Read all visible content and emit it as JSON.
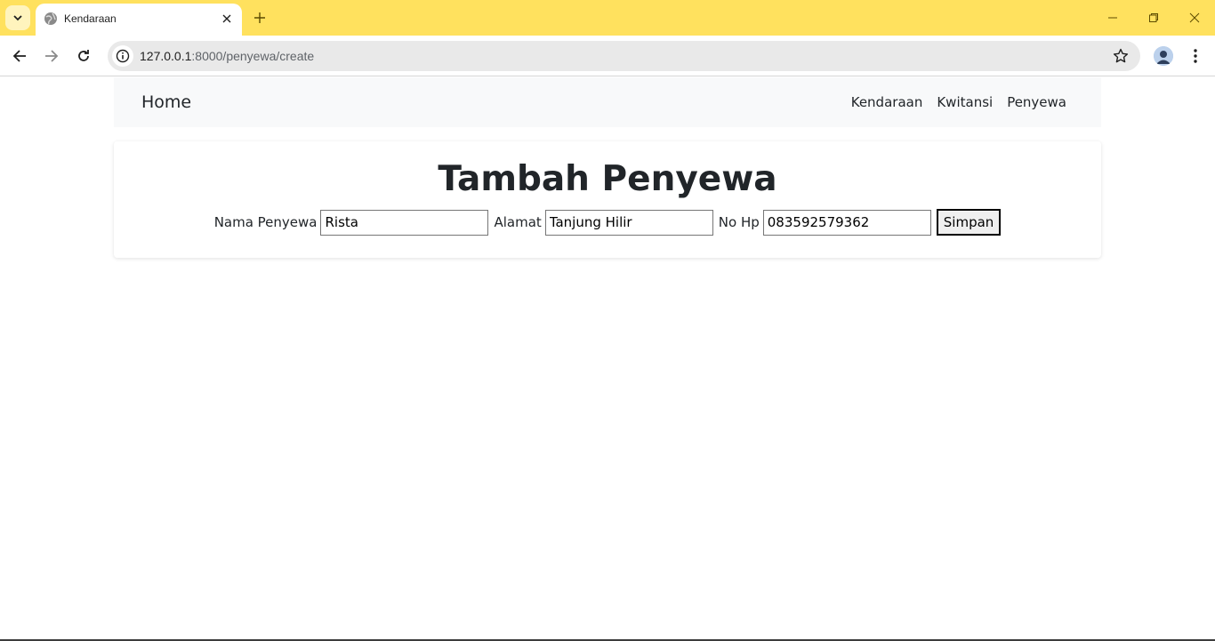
{
  "browser": {
    "tab_title": "Kendaraan",
    "url_host": "127.0.0.1",
    "url_path": ":8000/penyewa/create",
    "accent_color": "#ffe15e"
  },
  "navbar": {
    "brand": "Home",
    "links": [
      "Kendaraan",
      "Kwitansi",
      "Penyewa"
    ]
  },
  "form": {
    "title": "Tambah Penyewa",
    "nama_label": "Nama Penyewa",
    "nama_value": "Rista",
    "alamat_label": "Alamat",
    "alamat_value": "Tanjung Hilir",
    "hp_label": "No Hp",
    "hp_value": "083592579362",
    "submit_label": "Simpan"
  }
}
